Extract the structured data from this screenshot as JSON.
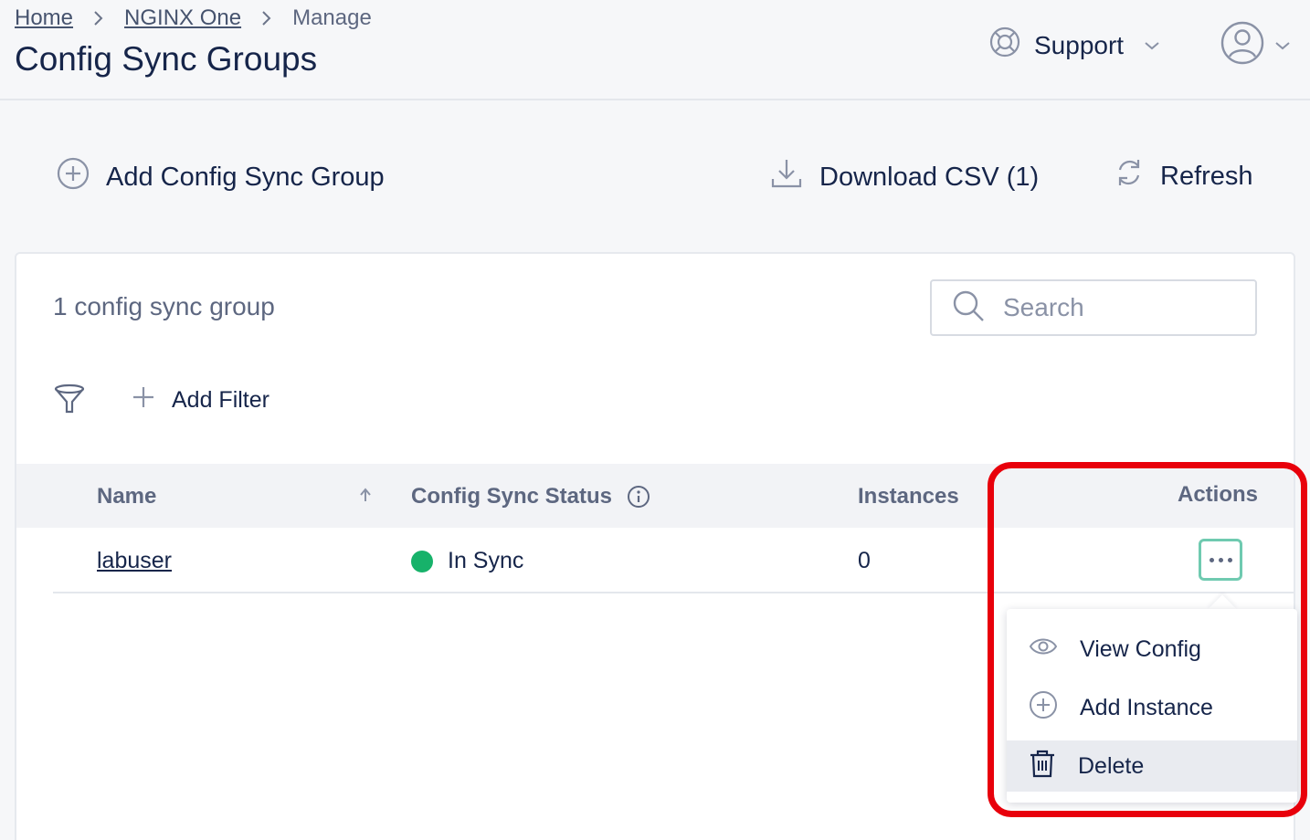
{
  "breadcrumb": {
    "home": "Home",
    "nginx_one": "NGINX One",
    "current": "Manage"
  },
  "header": {
    "title": "Config Sync Groups",
    "support_label": "Support"
  },
  "toolbar": {
    "add_label": "Add Config Sync Group",
    "download_label": "Download CSV (1)",
    "refresh_label": "Refresh"
  },
  "list": {
    "count_label": "1 config sync group",
    "search_placeholder": "Search",
    "add_filter_label": "Add Filter",
    "columns": {
      "name": "Name",
      "status": "Config Sync Status",
      "instances": "Instances",
      "actions": "Actions"
    },
    "rows": [
      {
        "name": "labuser",
        "status": "In Sync",
        "status_color": "#17b26a",
        "instances": "0"
      }
    ]
  },
  "actions_menu": {
    "items": [
      {
        "label": "View Config",
        "icon": "eye-icon"
      },
      {
        "label": "Add Instance",
        "icon": "plus-circle-icon"
      },
      {
        "label": "Delete",
        "icon": "trash-icon"
      }
    ]
  },
  "colors": {
    "accent_border": "#6fcab0",
    "highlight": "#e8000b",
    "text": "#16254a"
  }
}
